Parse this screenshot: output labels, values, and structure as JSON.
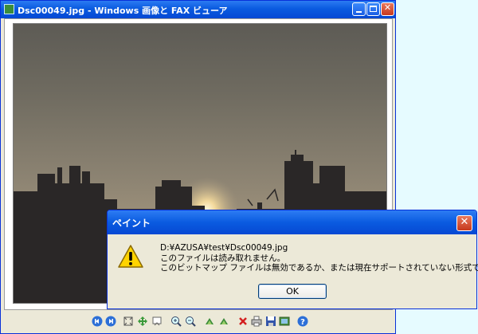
{
  "viewer": {
    "title": "Dsc00049.jpg - Windows 画像と FAX ビューア",
    "toolbar": [
      "previous-icon",
      "next-icon",
      "best-fit-icon",
      "actual-size-icon",
      "slideshow-icon",
      "zoom-in-icon",
      "zoom-out-icon",
      "rotate-clockwise-icon",
      "rotate-counterclockwise-icon",
      "delete-icon",
      "print-icon",
      "save-icon",
      "open-editor-icon",
      "help-icon"
    ]
  },
  "dialog": {
    "title": "ペイント",
    "line1": "D:¥AZUSA¥test¥Dsc00049.jpg",
    "line2": "このファイルは読み取れません。",
    "line3": "このビットマップ ファイルは無効であるか、または現在サポートされていない形式です。",
    "ok": "OK"
  },
  "colors": {
    "titlebar": "#0a5be0",
    "close": "#c6381d",
    "desktop": "#e6fbff"
  }
}
